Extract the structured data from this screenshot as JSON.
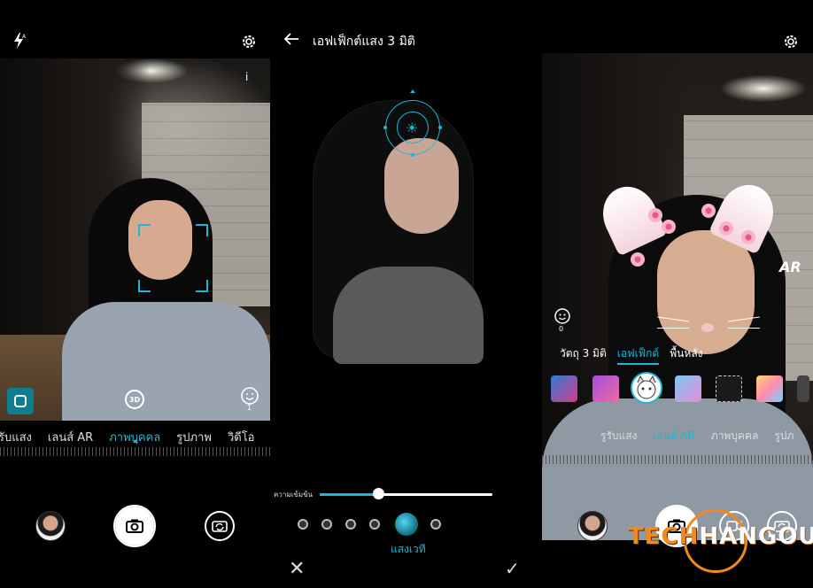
{
  "panel1": {
    "flash_icon": "flash-auto-icon",
    "settings_icon": "gear-icon",
    "info_label": "i",
    "beauty_count": "1",
    "modes": [
      "รับแสง",
      "เลนส์ AR",
      "ภาพบุคคล",
      "รูปภาพ",
      "วิดีโอ"
    ],
    "active_mode_index": 2
  },
  "panel2": {
    "title": "เอฟเฟ็กต์แสง 3 มิติ",
    "intensity_label": "ความเข้มข้น",
    "intensity_value": 0.34,
    "effect_count": 6,
    "selected_effect_index": 4,
    "selected_effect_label": "แสงเวที",
    "cancel_label": "✕",
    "confirm_label": "✓"
  },
  "panel3": {
    "settings_icon": "gear-icon",
    "ar_label": "AR",
    "face_count": "0",
    "tabs": [
      "วัตถุ 3 มิติ",
      "เอฟเฟ็กต์",
      "พื้นหลัง"
    ],
    "active_tab_index": 1,
    "modes": [
      "รูรับแสง",
      "เลนส์ AR",
      "ภาพบุคคล",
      "รูปภ"
    ],
    "active_mode_index": 1,
    "watermark_part1": "TECH",
    "watermark_part2": "HANGOUT"
  },
  "colors": {
    "accent": "#1fb6d6",
    "watermark": "#f08a1c"
  }
}
